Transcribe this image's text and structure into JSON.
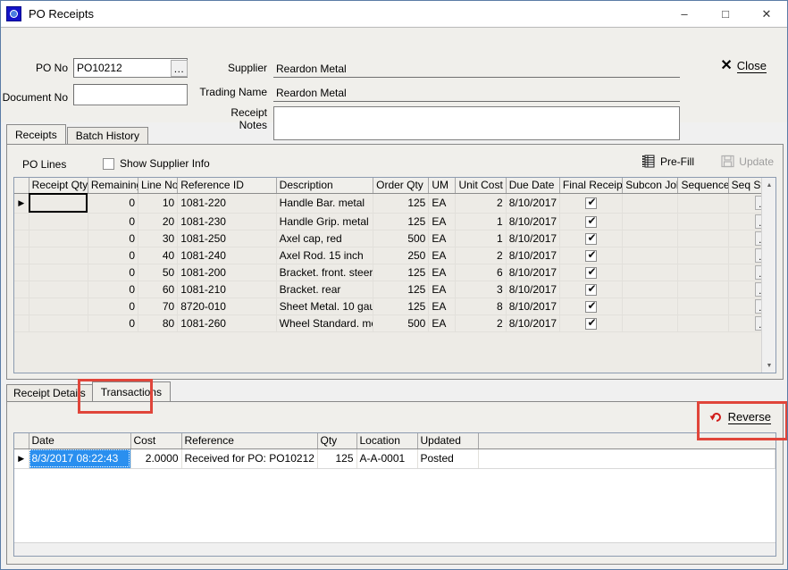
{
  "window": {
    "title": "PO Receipts",
    "icon": "app-icon",
    "minimize": "–",
    "maximize": "□",
    "close": "✕"
  },
  "header": {
    "po_no_label": "PO No",
    "po_no_value": "PO10212",
    "po_no_browse": "…",
    "document_no_label": "Document No",
    "document_no_value": "",
    "supplier_label": "Supplier",
    "supplier_value": "Reardon Metal",
    "trading_name_label": "Trading Name",
    "trading_name_value": "Reardon Metal",
    "receipt_notes_label": "Receipt Notes",
    "receipt_notes_value": "",
    "close_icon": "✖",
    "close_label": "Close"
  },
  "tabs": [
    {
      "label": "Receipts",
      "active": true
    },
    {
      "label": "Batch History",
      "active": false
    }
  ],
  "receipts_panel": {
    "po_lines_label": "PO Lines",
    "show_supplier_info_label": "Show Supplier Info",
    "show_supplier_info_checked": false,
    "prefill_label": "Pre-Fill",
    "update_label": "Update",
    "update_disabled": true,
    "columns": [
      "Receipt Qty",
      "Remaining",
      "Line No",
      "Reference ID",
      "Description",
      "Order Qty",
      "UM",
      "Unit Cost",
      "Due Date",
      "Final Receipt",
      "Subcon Job",
      "Sequence",
      "Seq Status"
    ],
    "rows": [
      {
        "receipt_qty": "",
        "remaining": "0",
        "line_no": "10",
        "reference_id": "1081-220",
        "description": "Handle Bar. metal",
        "order_qty": "125",
        "um": "EA",
        "unit_cost": "2",
        "due_date": "8/10/2017",
        "final_receipt": true,
        "subcon_job": "",
        "sequence": "",
        "seq_status": "…"
      },
      {
        "receipt_qty": "",
        "remaining": "0",
        "line_no": "20",
        "reference_id": "1081-230",
        "description": "Handle Grip. metal",
        "order_qty": "125",
        "um": "EA",
        "unit_cost": "1",
        "due_date": "8/10/2017",
        "final_receipt": true,
        "subcon_job": "",
        "sequence": "",
        "seq_status": "…"
      },
      {
        "receipt_qty": "",
        "remaining": "0",
        "line_no": "30",
        "reference_id": "1081-250",
        "description": "Axel cap, red",
        "order_qty": "500",
        "um": "EA",
        "unit_cost": "1",
        "due_date": "8/10/2017",
        "final_receipt": true,
        "subcon_job": "",
        "sequence": "",
        "seq_status": "…"
      },
      {
        "receipt_qty": "",
        "remaining": "0",
        "line_no": "40",
        "reference_id": "1081-240",
        "description": "Axel Rod. 15 inch",
        "order_qty": "250",
        "um": "EA",
        "unit_cost": "2",
        "due_date": "8/10/2017",
        "final_receipt": true,
        "subcon_job": "",
        "sequence": "",
        "seq_status": "…"
      },
      {
        "receipt_qty": "",
        "remaining": "0",
        "line_no": "50",
        "reference_id": "1081-200",
        "description": "Bracket. front. steer",
        "order_qty": "125",
        "um": "EA",
        "unit_cost": "6",
        "due_date": "8/10/2017",
        "final_receipt": true,
        "subcon_job": "",
        "sequence": "",
        "seq_status": "…"
      },
      {
        "receipt_qty": "",
        "remaining": "0",
        "line_no": "60",
        "reference_id": "1081-210",
        "description": "Bracket. rear",
        "order_qty": "125",
        "um": "EA",
        "unit_cost": "3",
        "due_date": "8/10/2017",
        "final_receipt": true,
        "subcon_job": "",
        "sequence": "",
        "seq_status": "…"
      },
      {
        "receipt_qty": "",
        "remaining": "0",
        "line_no": "70",
        "reference_id": "8720-010",
        "description": "Sheet Metal. 10 gau",
        "order_qty": "125",
        "um": "EA",
        "unit_cost": "8",
        "due_date": "8/10/2017",
        "final_receipt": true,
        "subcon_job": "",
        "sequence": "",
        "seq_status": "…"
      },
      {
        "receipt_qty": "",
        "remaining": "0",
        "line_no": "80",
        "reference_id": "1081-260",
        "description": "Wheel Standard. me",
        "order_qty": "500",
        "um": "EA",
        "unit_cost": "2",
        "due_date": "8/10/2017",
        "final_receipt": true,
        "subcon_job": "",
        "sequence": "",
        "seq_status": "…"
      }
    ]
  },
  "lower_tabs": [
    {
      "label": "Receipt Details",
      "active": false
    },
    {
      "label": "Transactions",
      "active": true,
      "highlighted": true
    }
  ],
  "transactions_panel": {
    "reverse_label": "Reverse",
    "reverse_icon": "undo-arrow-icon",
    "reverse_highlighted": true,
    "columns": [
      "Date",
      "Cost",
      "Reference",
      "Qty",
      "Location",
      "Updated"
    ],
    "rows": [
      {
        "date": "8/3/2017 08:22:43",
        "cost": "2.0000",
        "reference": "Received for PO: PO10212",
        "qty": "125",
        "location": "A-A-0001",
        "updated": "Posted",
        "selected": true
      }
    ]
  },
  "colors": {
    "accent_red": "#e0453a",
    "selection_blue": "#2a8fef",
    "panel_bg": "#f0efeb",
    "grid_bg": "#edebe6",
    "window_border": "#5b7ca6"
  }
}
